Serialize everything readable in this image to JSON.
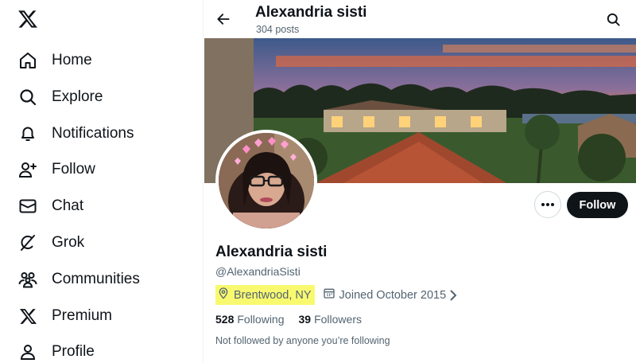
{
  "sidebar": {
    "logo_icon": "x-logo-icon",
    "items": [
      {
        "label": "Home",
        "icon": "home-icon"
      },
      {
        "label": "Explore",
        "icon": "search-icon"
      },
      {
        "label": "Notifications",
        "icon": "bell-icon"
      },
      {
        "label": "Follow",
        "icon": "person-add-icon"
      },
      {
        "label": "Chat",
        "icon": "envelope-icon"
      },
      {
        "label": "Grok",
        "icon": "grok-icon"
      },
      {
        "label": "Communities",
        "icon": "people-icon"
      },
      {
        "label": "Premium",
        "icon": "x-premium-icon"
      },
      {
        "label": "Profile",
        "icon": "person-icon"
      }
    ]
  },
  "header": {
    "title": "Alexandria sisti",
    "post_count": "304 posts"
  },
  "profile": {
    "display_name": "Alexandria sisti",
    "handle": "@AlexandriaSisti",
    "location": "Brentwood, NY",
    "joined": "Joined October 2015",
    "following_count": "528",
    "following_label": "Following",
    "followers_count": "39",
    "followers_label": "Followers",
    "not_followed_text": "Not followed by anyone you’re following",
    "follow_button": "Follow"
  },
  "colors": {
    "text": "#0f1419",
    "secondary": "#536471",
    "highlight": "#f9f970",
    "button_bg": "#0f1419"
  }
}
